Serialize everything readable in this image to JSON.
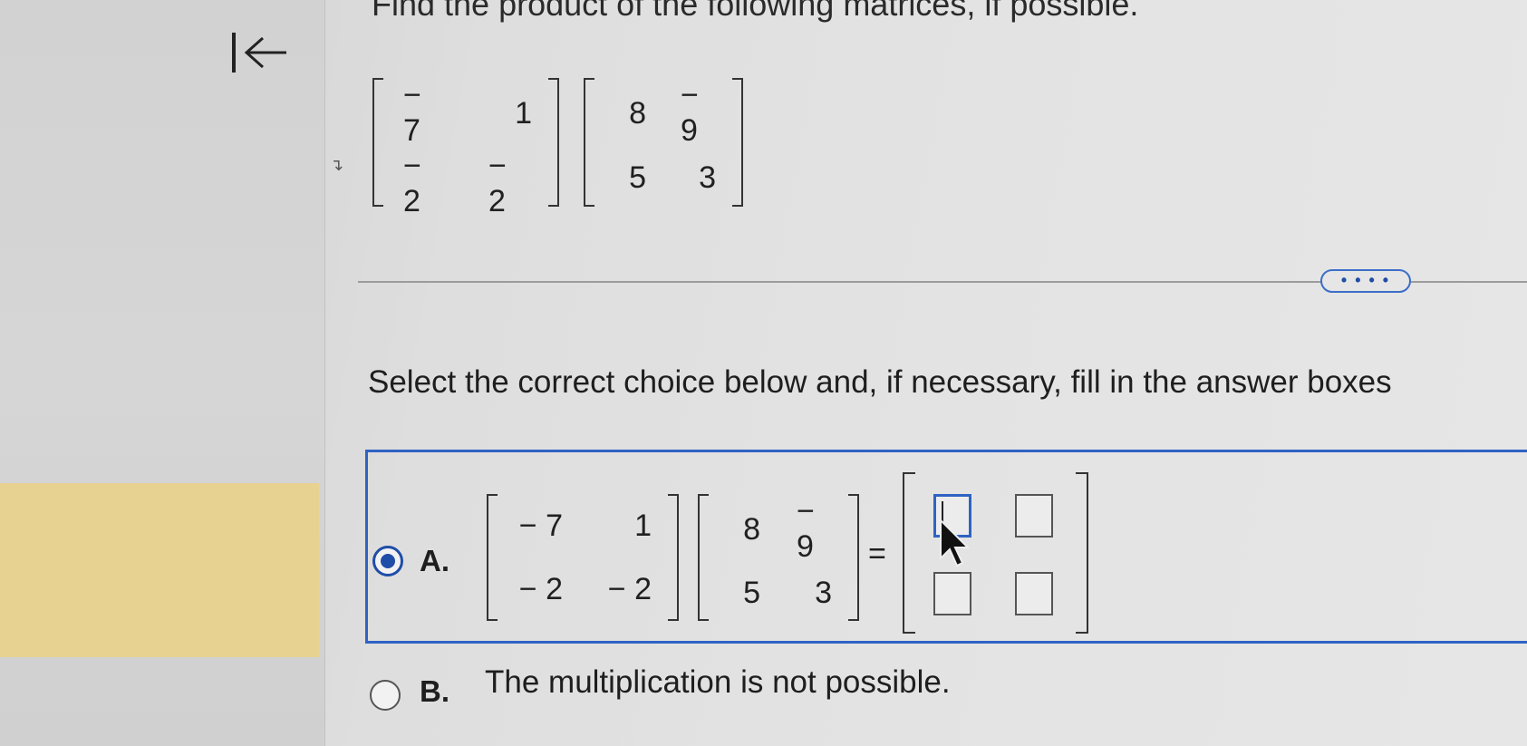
{
  "navigation": {
    "back_icon": "first-page-arrow-icon"
  },
  "question": {
    "title": "Find the product of the following matrices, if possible.",
    "marker": "↴",
    "matrix_a": [
      [
        "− 7",
        "1"
      ],
      [
        "− 2",
        "− 2"
      ]
    ],
    "matrix_b": [
      [
        "8",
        "− 9"
      ],
      [
        "5",
        "3"
      ]
    ]
  },
  "more_button_label": "• • • •",
  "instruction": "Select the correct choice below and, if necessary, fill in the answer boxes",
  "choices": {
    "a": {
      "letter": "A.",
      "selected": true,
      "matrix_a": [
        [
          "− 7",
          "1"
        ],
        [
          "− 2",
          "− 2"
        ]
      ],
      "matrix_b": [
        [
          "8",
          "− 9"
        ],
        [
          "5",
          "3"
        ]
      ],
      "equals": "=",
      "answer_boxes": [
        [
          "",
          ""
        ],
        [
          "",
          ""
        ]
      ]
    },
    "b": {
      "letter": "B.",
      "selected": false,
      "text": "The multiplication is not possible."
    }
  },
  "colors": {
    "accent": "#2f63c4",
    "highlight": "#e8d291"
  }
}
